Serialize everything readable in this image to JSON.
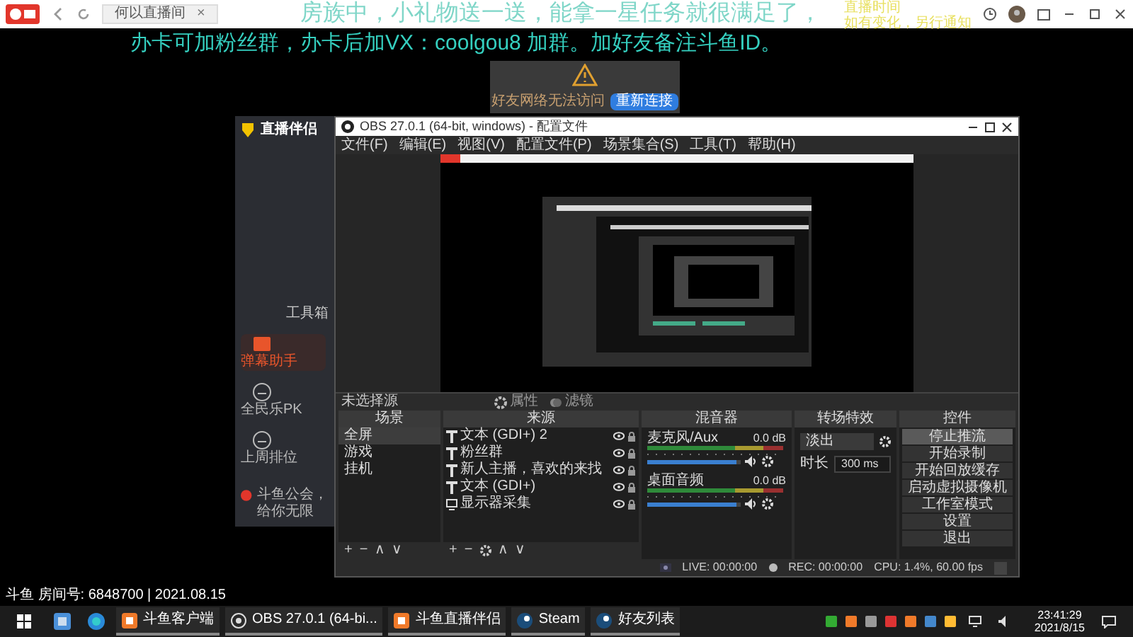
{
  "client_bar": {
    "tab": "何以直播间",
    "tab_close": "×"
  },
  "overlay": {
    "scroll_text": "房族中，小礼物送一送，能拿一星任务就很满足了，",
    "notice": "办卡可加粉丝群，办卡后加VX：coolgou8  加群。加好友备注斗鱼ID。",
    "schedule": [
      "直播时间",
      "如有变化，另行通知"
    ]
  },
  "dialog": {
    "message": "好友网络无法访问",
    "button": "重新连接"
  },
  "companion": {
    "logo": "直播伴侣",
    "section": "工具箱",
    "tools": [
      {
        "label": "弹幕助手",
        "selected": true
      },
      {
        "label": "全民乐PK",
        "selected": false
      },
      {
        "label": "上周排位",
        "selected": false
      }
    ],
    "footer": "斗鱼公会，给你无限"
  },
  "obs": {
    "title": "OBS 27.0.1 (64-bit, windows) - 配置文件",
    "menu": [
      "文件(F)",
      "编辑(E)",
      "视图(V)",
      "配置文件(P)",
      "场景集合(S)",
      "工具(T)",
      "帮助(H)"
    ],
    "source_bar": {
      "label": "未选择源",
      "buttons": [
        "属性",
        "滤镜"
      ]
    },
    "scenes": {
      "title": "场景",
      "items": [
        {
          "label": "全屏",
          "selected": true
        },
        {
          "label": "游戏",
          "selected": false
        },
        {
          "label": "挂机",
          "selected": false
        }
      ],
      "tools": [
        "+",
        "−",
        "∧",
        "∨"
      ]
    },
    "sources": {
      "title": "来源",
      "items": [
        {
          "label": "文本 (GDI+) 2",
          "kind": "text"
        },
        {
          "label": "粉丝群",
          "kind": "text"
        },
        {
          "label": "新人主播，喜欢的来找",
          "kind": "text"
        },
        {
          "label": "文本 (GDI+)",
          "kind": "text"
        },
        {
          "label": "显示器采集",
          "kind": "display"
        }
      ],
      "tools": [
        "+",
        "−",
        "∧",
        "∨"
      ]
    },
    "mixer": {
      "title": "混音器",
      "channels": [
        {
          "name": "麦克风/Aux",
          "reading": "0.0 dB",
          "level": 0.95
        },
        {
          "name": "桌面音频",
          "reading": "0.0 dB",
          "level": 0.95
        }
      ]
    },
    "transitions": {
      "title": "转场特效",
      "type": "淡出",
      "duration_label": "时长",
      "duration": "300 ms"
    },
    "controls": {
      "title": "控件",
      "buttons": [
        {
          "label": "停止推流",
          "selected": true
        },
        {
          "label": "开始录制",
          "selected": false
        },
        {
          "label": "开始回放缓存",
          "selected": false
        },
        {
          "label": "启动虚拟摄像机",
          "selected": false
        },
        {
          "label": "工作室模式",
          "selected": false
        },
        {
          "label": "设置",
          "selected": false
        },
        {
          "label": "退出",
          "selected": false
        }
      ]
    },
    "status": {
      "live": "LIVE: 00:00:00",
      "rec": "REC: 00:00:00",
      "cpu": "CPU: 1.4%, 60.00 fps"
    }
  },
  "room_info": "斗鱼 房间号: 6848700 | 2021.08.15",
  "taskbar": {
    "apps": [
      {
        "label": "斗鱼客户端",
        "kind": "douyu"
      },
      {
        "label": "OBS 27.0.1 (64-bi...",
        "kind": "obs"
      },
      {
        "label": "斗鱼直播伴侣",
        "kind": "douyu"
      },
      {
        "label": "Steam",
        "kind": "steam"
      },
      {
        "label": "好友列表",
        "kind": "steam"
      }
    ],
    "time": "23:41:29",
    "date": "2021/8/15"
  }
}
